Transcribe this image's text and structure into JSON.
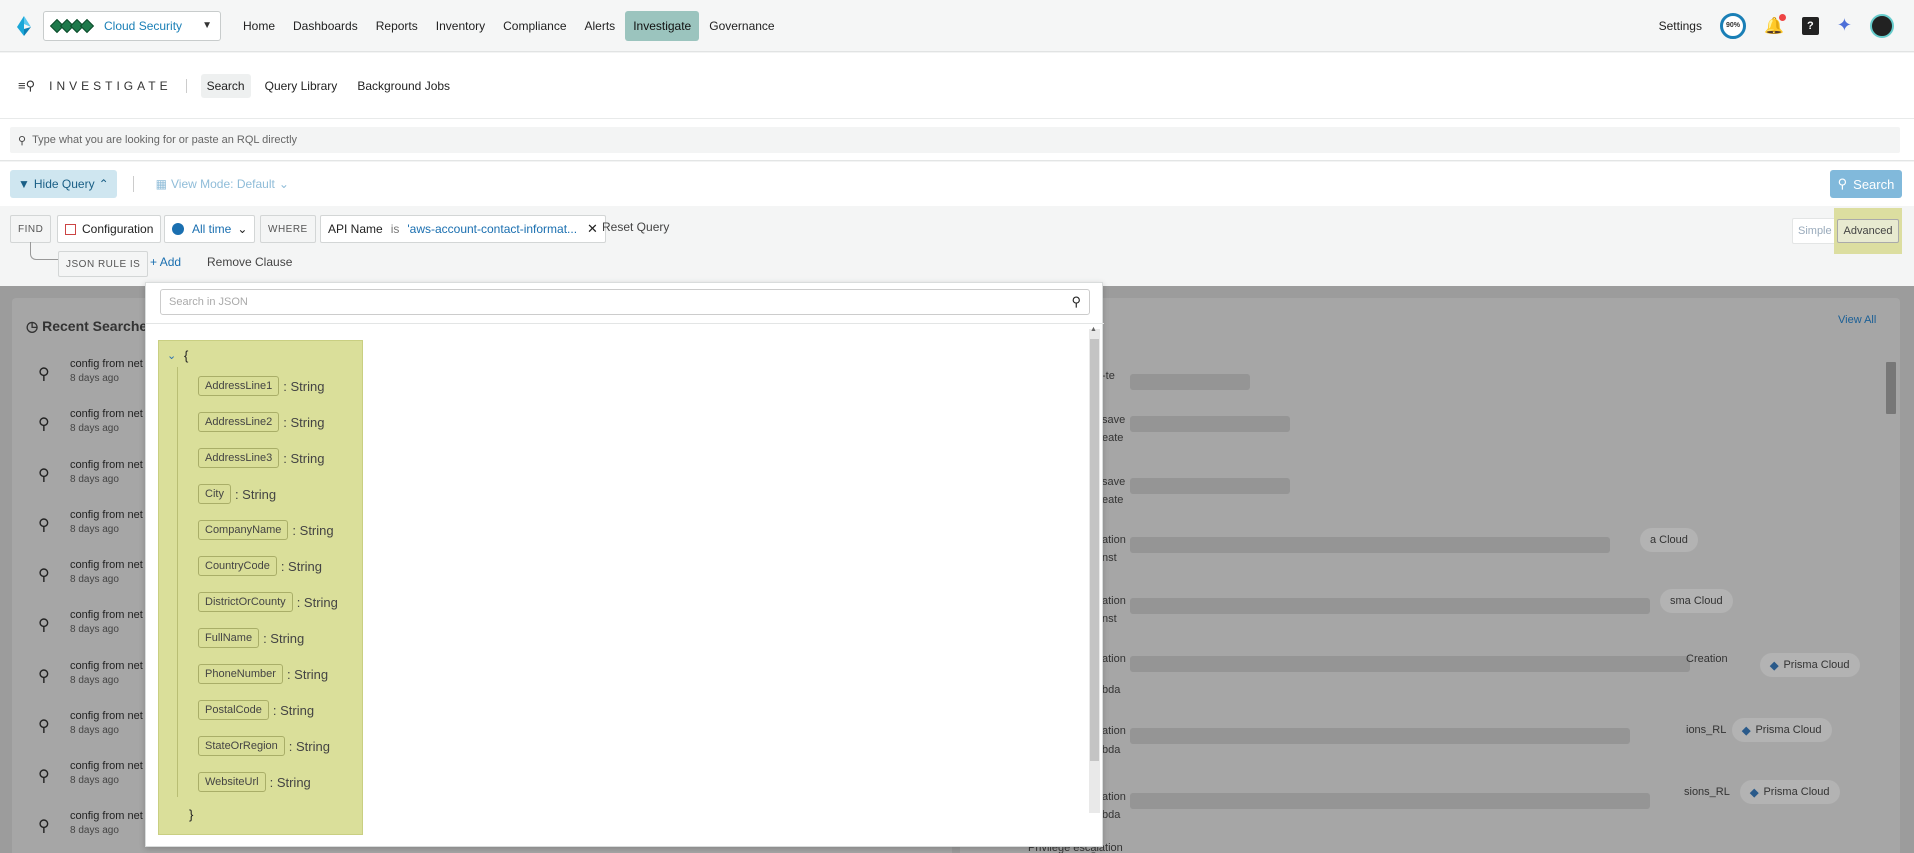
{
  "nav": {
    "tenant": "Cloud Security",
    "links": [
      "Home",
      "Dashboards",
      "Reports",
      "Inventory",
      "Compliance",
      "Alerts",
      "Investigate",
      "Governance"
    ],
    "active": "Investigate",
    "settings": "Settings",
    "progress": "90%"
  },
  "subheader": {
    "title": "INVESTIGATE",
    "tabs": [
      "Search",
      "Query Library",
      "Background Jobs"
    ]
  },
  "rql": {
    "placeholder": "Type what you are looking for or paste an RQL directly"
  },
  "toolbar": {
    "hide_query": "Hide Query",
    "view_mode": "View Mode: Default",
    "search": "Search"
  },
  "builder": {
    "find": "FIND",
    "configuration": "Configuration",
    "time": "All time",
    "where": "WHERE",
    "api_name": "API Name",
    "is": "is",
    "api_value": "'aws-account-contact-informat...",
    "reset": "Reset Query",
    "simple": "Simple",
    "advanced": "Advanced",
    "json_rule": "JSON RULE IS",
    "add": "Add",
    "remove_clause": "Remove Clause"
  },
  "background": {
    "recent_title": "Recent Searches",
    "view_all": "View All",
    "recent": [
      {
        "q": "config from net",
        "t": "8 days ago"
      },
      {
        "q": "config from net",
        "t": "8 days ago"
      },
      {
        "q": "config from net",
        "t": "8 days ago"
      },
      {
        "q": "config from net",
        "t": "8 days ago"
      },
      {
        "q": "config from net",
        "t": "8 days ago"
      },
      {
        "q": "config from net",
        "t": "8 days ago"
      },
      {
        "q": "config from net",
        "t": "8 days ago"
      },
      {
        "q": "config from net",
        "t": "8 days ago"
      },
      {
        "q": "config from net",
        "t": "8 days ago"
      },
      {
        "q": "config from net",
        "t": "8 days ago"
      }
    ],
    "right_fragments": [
      "-te",
      "save",
      "eate",
      "save",
      "eate",
      "ation",
      "nst",
      "ation",
      "nst",
      "ation",
      "bda",
      "ation",
      "bda",
      "ation",
      "bda",
      "Privilege escalation"
    ],
    "pills": [
      {
        "pre": "",
        "label": "a Cloud"
      },
      {
        "pre": "",
        "label": "sma Cloud"
      },
      {
        "pre": "Creation",
        "label": "Prisma Cloud"
      },
      {
        "pre": "ions_RL",
        "label": "Prisma Cloud"
      },
      {
        "pre": "sions_RL",
        "label": "Prisma Cloud"
      }
    ]
  },
  "json_popup": {
    "search_placeholder": "Search in JSON",
    "open_brace": "{",
    "close_brace": "}",
    "fields": [
      {
        "key": "AddressLine1",
        "type": ": String"
      },
      {
        "key": "AddressLine2",
        "type": ": String"
      },
      {
        "key": "AddressLine3",
        "type": ": String"
      },
      {
        "key": "City",
        "type": ": String"
      },
      {
        "key": "CompanyName",
        "type": ": String"
      },
      {
        "key": "CountryCode",
        "type": ": String"
      },
      {
        "key": "DistrictOrCounty",
        "type": ": String"
      },
      {
        "key": "FullName",
        "type": ": String"
      },
      {
        "key": "PhoneNumber",
        "type": ": String"
      },
      {
        "key": "PostalCode",
        "type": ": String"
      },
      {
        "key": "StateOrRegion",
        "type": ": String"
      },
      {
        "key": "WebsiteUrl",
        "type": ": String"
      }
    ]
  }
}
